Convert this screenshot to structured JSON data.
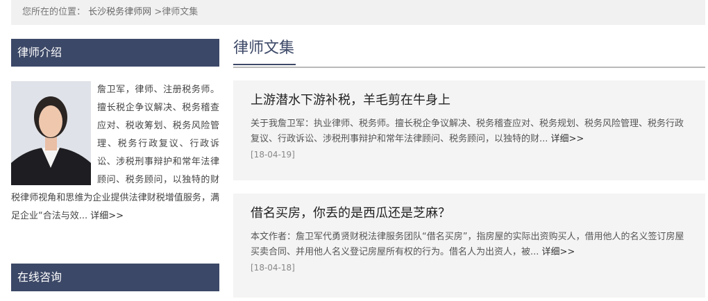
{
  "breadcrumb": {
    "prefix": "您所在的位置：",
    "home": "长沙税务律师网",
    "separator": ">",
    "current": "律师文集"
  },
  "sidebar": {
    "intro_title": "律师介绍",
    "intro_text": "詹卫军，律师、注册税务师。擅长税企争议解决、税务稽查应对、税收筹划、税务风险管理、税务行政复议、行政诉讼、涉税刑事辩护和常年法律顾问、税务顾问，以独特的财税律师视角和思维为企业提供法律财税增值服务，满足企业“合法与效... ",
    "intro_more": "详细>>",
    "consult_title": "在线咨询"
  },
  "main": {
    "title": "律师文集",
    "articles": [
      {
        "title": "上游潜水下游补税，羊毛剪在牛身上",
        "summary": "关于我詹卫军：执业律师、税务师。擅长税企争议解决、税务稽查应对、税务规划、税务风险管理、税务行政复议、行政诉讼、涉税刑事辩护和常年法律顾问、税务顾问，以独特的财... ",
        "more": "详细>>",
        "date": "[18-04-19]"
      },
      {
        "title": "借名买房，你丢的是西瓜还是芝麻？",
        "summary": "本文作者：詹卫军代勇贤财税法律服务团队“借名买房”，指房屋的实际出资购买人，借用他人的名义签订房屋买卖合同、并用他人名义登记房屋所有权的行为。借名人为出资人，被... ",
        "more": "详细>>",
        "date": "[18-04-18]"
      }
    ]
  }
}
